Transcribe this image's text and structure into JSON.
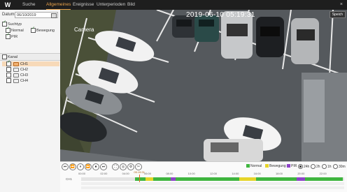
{
  "app": {
    "logo": "W"
  },
  "tabs": [
    {
      "label": "Suche"
    },
    {
      "label": "Allgemeines"
    },
    {
      "label": "Ereignisse"
    },
    {
      "label": "Unterperioden"
    },
    {
      "label": "Bild"
    }
  ],
  "window": {
    "close": "×"
  },
  "sidebar": {
    "date_label": "Datum:",
    "date_value": "06/10/2019",
    "section_type": "Suchtyp",
    "types": [
      {
        "label": "Normal",
        "checked": true
      },
      {
        "label": "Bewegung",
        "checked": true
      },
      {
        "label": "PIR",
        "checked": true
      }
    ],
    "kanal_label": "Kanal",
    "channels": [
      {
        "label": "CH1",
        "checked": true,
        "selected": true
      },
      {
        "label": "CH2",
        "checked": false,
        "selected": false
      },
      {
        "label": "CH3",
        "checked": false,
        "selected": false
      },
      {
        "label": "CH4",
        "checked": false,
        "selected": false
      }
    ]
  },
  "video": {
    "timestamp": "2019-06-10  05:19:31",
    "camera_label": "Camera",
    "speed_button": "Speich"
  },
  "controls": {
    "buttons": [
      "⏮",
      "⏪",
      "⏸",
      "⏩",
      "⏹",
      "⏭",
      "⛶",
      "◎",
      "⚙",
      "✂"
    ],
    "legend": [
      {
        "label": "Normal",
        "color": "#3fb53f"
      },
      {
        "label": "Bewegung",
        "color": "#e6d52a"
      },
      {
        "label": "PIR",
        "color": "#8e44c8"
      }
    ],
    "ranges": [
      {
        "label": "24h",
        "selected": true
      },
      {
        "label": "2h",
        "selected": false
      },
      {
        "label": "1h",
        "selected": false
      },
      {
        "label": "30m",
        "selected": false
      }
    ]
  },
  "timeline": {
    "ticks": [
      "00:00",
      "02:00",
      "04:00",
      "06:00",
      "08:00",
      "10:00",
      "12:00",
      "14:00",
      "16:00",
      "18:00",
      "20:00",
      "22:00"
    ],
    "cursor_label": "05:19:31",
    "cursor_position": 0.2219,
    "track_label": "CH1",
    "segments": [
      {
        "start": 0.205,
        "end": 0.455,
        "type": "normal"
      },
      {
        "start": 0.245,
        "end": 0.275,
        "type": "motion"
      },
      {
        "start": 0.34,
        "end": 0.36,
        "type": "pir"
      },
      {
        "start": 0.455,
        "end": 0.6,
        "type": "normal"
      },
      {
        "start": 0.6,
        "end": 0.665,
        "type": "motion"
      },
      {
        "start": 0.665,
        "end": 0.82,
        "type": "normal"
      },
      {
        "start": 0.82,
        "end": 0.85,
        "type": "pir"
      },
      {
        "start": 0.85,
        "end": 0.995,
        "type": "normal"
      }
    ]
  }
}
